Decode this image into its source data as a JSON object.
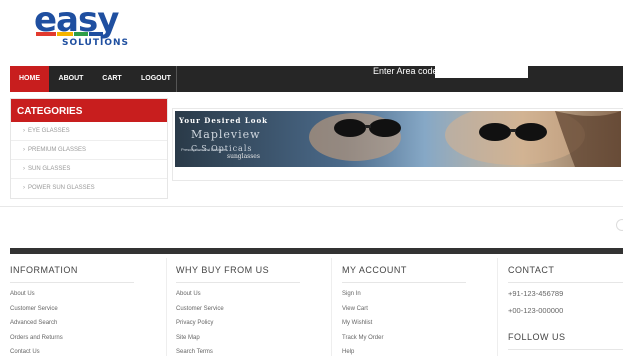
{
  "brand": {
    "logo_word": "easy",
    "logo_sub": "SOLUTIONS",
    "bar_colors": [
      "#e23a2e",
      "#f5b400",
      "#2e9e48",
      "#1f4fa0"
    ]
  },
  "nav": {
    "items": [
      {
        "label": "HOME",
        "active": true
      },
      {
        "label": "ABOUT"
      },
      {
        "label": "CART"
      },
      {
        "label": "LOGOUT"
      }
    ],
    "area_label": "Enter Area code:",
    "area_value": ""
  },
  "categories": {
    "title": "CATEGORIES",
    "items": [
      "EYE GLASSES",
      "PREMIUM GLASSES",
      "SUN GLASSES",
      "POWER SUN GLASSES"
    ]
  },
  "banner": {
    "tagline": "Your Desired Look",
    "brand": "Mapleview",
    "brand2": "C.S.Opticals",
    "small": "Prescription and Designer",
    "sub": "sunglasses"
  },
  "footer": {
    "information": {
      "title": "INFORMATION",
      "links": [
        "About Us",
        "Customer Service",
        "Advanced Search",
        "Orders and Returns",
        "Contact Us"
      ]
    },
    "why": {
      "title": "WHY BUY FROM US",
      "links": [
        "About Us",
        "Customer Service",
        "Privacy Policy",
        "Site Map",
        "Search Terms"
      ]
    },
    "account": {
      "title": "MY ACCOUNT",
      "links": [
        "Sign In",
        "View Cart",
        "My Wishlist",
        "Track My Order",
        "Help"
      ]
    },
    "contact": {
      "title": "CONTACT",
      "phones": [
        "+91-123-456789",
        "+00-123-000000"
      ],
      "follow": "FOLLOW US"
    }
  }
}
